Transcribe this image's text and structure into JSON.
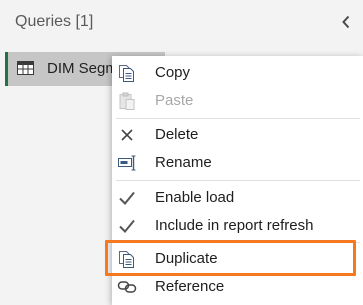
{
  "queries_pane": {
    "header_label": "Queries [1]",
    "collapse_icon": "chevron-left-icon",
    "query_item": {
      "label": "DIM Segm",
      "icon": "table-icon"
    }
  },
  "context_menu": {
    "items": [
      {
        "label": "Copy",
        "icon": "copy-icon",
        "enabled": true
      },
      {
        "label": "Paste",
        "icon": "paste-icon",
        "enabled": false
      },
      {
        "label": "Delete",
        "icon": "delete-icon",
        "enabled": true
      },
      {
        "label": "Rename",
        "icon": "rename-icon",
        "enabled": true
      },
      {
        "label": "Enable load",
        "icon": "checkmark-icon",
        "enabled": true,
        "checked": true
      },
      {
        "label": "Include in report refresh",
        "icon": "checkmark-icon",
        "enabled": true,
        "checked": true
      },
      {
        "label": "Duplicate",
        "icon": "duplicate-icon",
        "enabled": true,
        "highlighted": true
      },
      {
        "label": "Reference",
        "icon": "reference-icon",
        "enabled": true
      }
    ]
  },
  "colors": {
    "pane_background": "#f3f3f3",
    "selected_item_background": "#c6c6c6",
    "selected_item_accent": "#217346",
    "highlight_border": "#f47920"
  }
}
